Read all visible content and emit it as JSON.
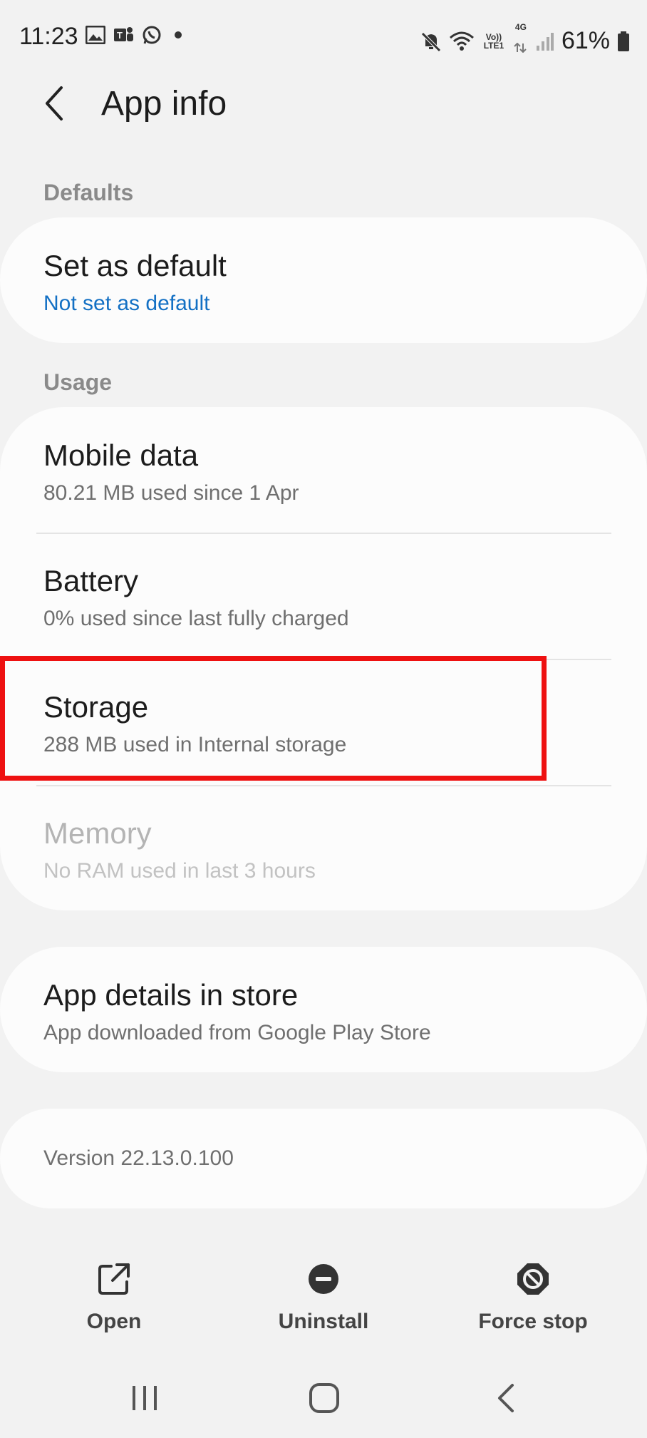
{
  "status_bar": {
    "time": "11:23",
    "signal_labels": {
      "volte": "Vo)) LTE1",
      "network": "4G"
    },
    "battery_percent": "61%",
    "icons": [
      "gallery-icon",
      "teams-icon",
      "whatsapp-icon",
      "dot-icon",
      "mute-icon",
      "wifi-icon",
      "signal-icon",
      "battery-icon"
    ]
  },
  "app_bar": {
    "title": "App info"
  },
  "sections": {
    "defaults_header": "Defaults",
    "usage_header": "Usage"
  },
  "defaults": {
    "set_as_default": {
      "title": "Set as default",
      "subtitle": "Not set as default"
    }
  },
  "usage": {
    "mobile_data": {
      "title": "Mobile data",
      "subtitle": "80.21 MB used since 1 Apr"
    },
    "battery": {
      "title": "Battery",
      "subtitle": "0% used since last fully charged"
    },
    "storage": {
      "title": "Storage",
      "subtitle": "288 MB used in Internal storage"
    },
    "memory": {
      "title": "Memory",
      "subtitle": "No RAM used in last 3 hours"
    }
  },
  "store": {
    "title": "App details in store",
    "subtitle": "App downloaded from Google Play Store"
  },
  "version": {
    "text": "Version 22.13.0.100"
  },
  "actions": {
    "open": "Open",
    "uninstall": "Uninstall",
    "force_stop": "Force stop"
  },
  "colors": {
    "background": "#f2f2f2",
    "card": "#fcfcfc",
    "link": "#1370c4",
    "highlight": "#ee1111"
  }
}
